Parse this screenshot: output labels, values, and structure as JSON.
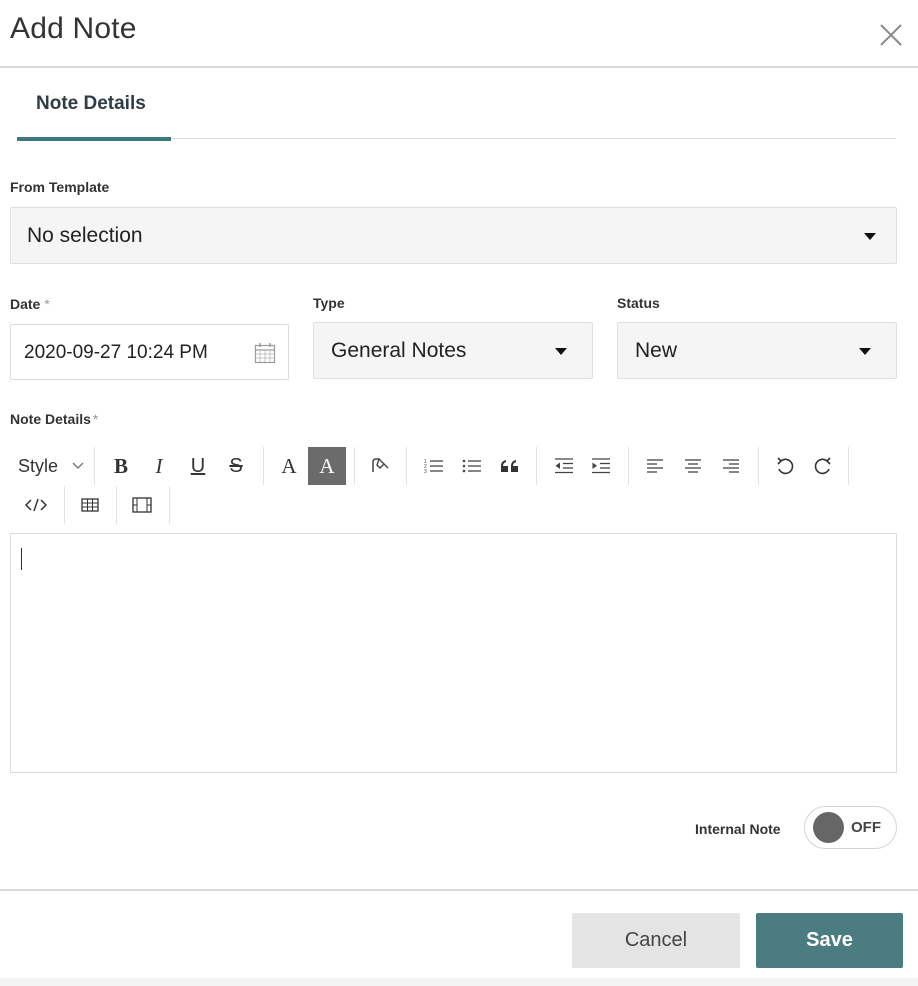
{
  "dialog": {
    "title": "Add Note",
    "close_icon": "close-icon"
  },
  "tabs": [
    {
      "label": "Note Details",
      "active": true
    }
  ],
  "colors": {
    "accent": "#4a7c82",
    "tab_underline": "#3d7a80",
    "cancel_bg": "#e4e4e4",
    "field_bg": "#f5f5f5",
    "toggle_knob": "#666666"
  },
  "form": {
    "from_template": {
      "label": "From Template",
      "value": "No selection"
    },
    "date": {
      "label": "Date",
      "required_mark": "*",
      "value": "2020-09-27 10:24 PM",
      "icon": "calendar-icon"
    },
    "type": {
      "label": "Type",
      "value": "General Notes"
    },
    "status": {
      "label": "Status",
      "value": "New"
    },
    "note_details": {
      "label": "Note Details",
      "required_mark": "*",
      "content": ""
    }
  },
  "toolbar": {
    "style_label": "Style",
    "bold": "B",
    "italic": "I",
    "underline": "U",
    "strike": "S",
    "font_color": "A",
    "bg_color": "A",
    "buttons": [
      "style-dropdown",
      "bold-button",
      "italic-button",
      "underline-button",
      "strikethrough-button",
      "font-color-button",
      "background-color-button",
      "format-painter-button",
      "numbered-list-button",
      "bullet-list-button",
      "blockquote-button",
      "outdent-button",
      "indent-button",
      "align-left-button",
      "align-center-button",
      "align-right-button",
      "undo-button",
      "redo-button",
      "source-code-button",
      "insert-table-button",
      "insert-media-button"
    ]
  },
  "internal_note": {
    "label": "Internal Note",
    "state": "OFF"
  },
  "footer": {
    "cancel_label": "Cancel",
    "save_label": "Save"
  }
}
